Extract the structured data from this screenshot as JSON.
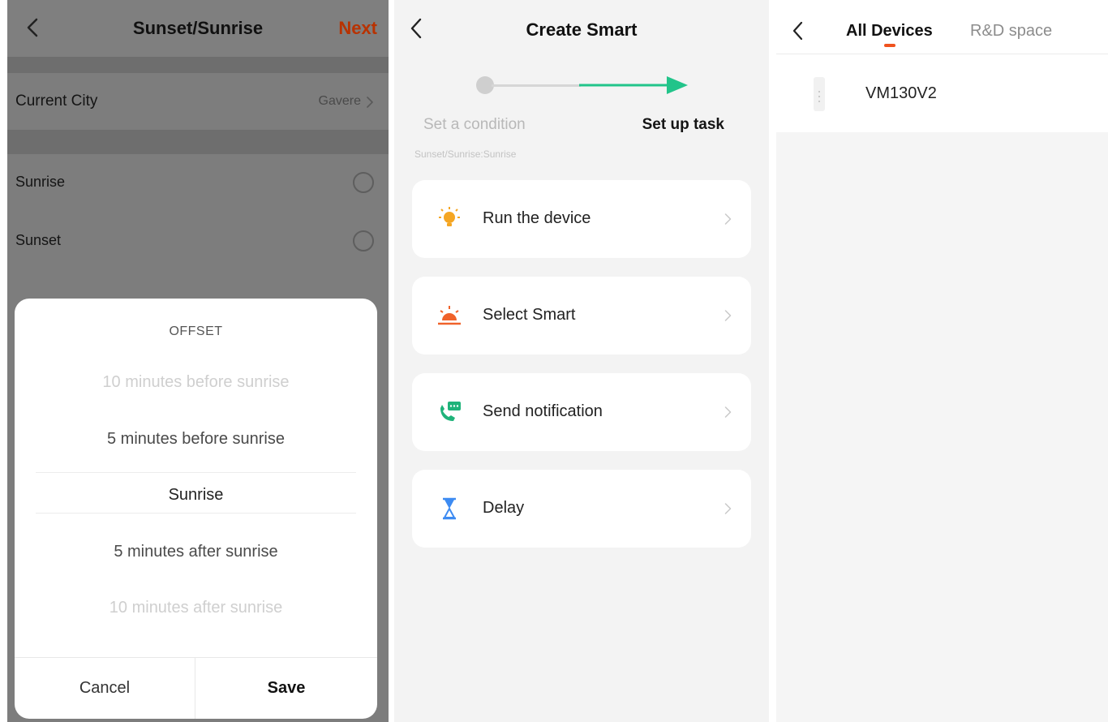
{
  "condition_screen": {
    "title": "Sunset/Sunrise",
    "next_label": "Next",
    "current_city_label": "Current City",
    "current_city_value": "Gavere",
    "options": [
      {
        "label": "Sunrise"
      },
      {
        "label": "Sunset"
      }
    ]
  },
  "offset_sheet": {
    "title": "OFFSET",
    "values": [
      "10 minutes before sunrise",
      "5 minutes before sunrise",
      "Sunrise",
      "5 minutes after sunrise",
      "10 minutes after sunrise"
    ],
    "selected": "Sunrise",
    "cancel_label": "Cancel",
    "save_label": "Save"
  },
  "create_smart": {
    "title": "Create Smart",
    "step_condition": "Set a condition",
    "step_task": "Set up task",
    "condition_summary": "Sunset/Sunrise:Sunrise",
    "tasks": [
      {
        "label": "Run the device",
        "icon": "bulb-icon",
        "color": "#f5a623"
      },
      {
        "label": "Select Smart",
        "icon": "sunrise-icon",
        "color": "#f0622a"
      },
      {
        "label": "Send notification",
        "icon": "phone-message-icon",
        "color": "#1fb37a"
      },
      {
        "label": "Delay",
        "icon": "hourglass-icon",
        "color": "#3d8bf2"
      }
    ]
  },
  "device_list": {
    "tabs": [
      "All Devices",
      "R&D space"
    ],
    "active_tab": "All Devices",
    "accent": "#f0521e",
    "devices": [
      {
        "name": "VM130V2",
        "icon": "device-icon"
      }
    ]
  }
}
